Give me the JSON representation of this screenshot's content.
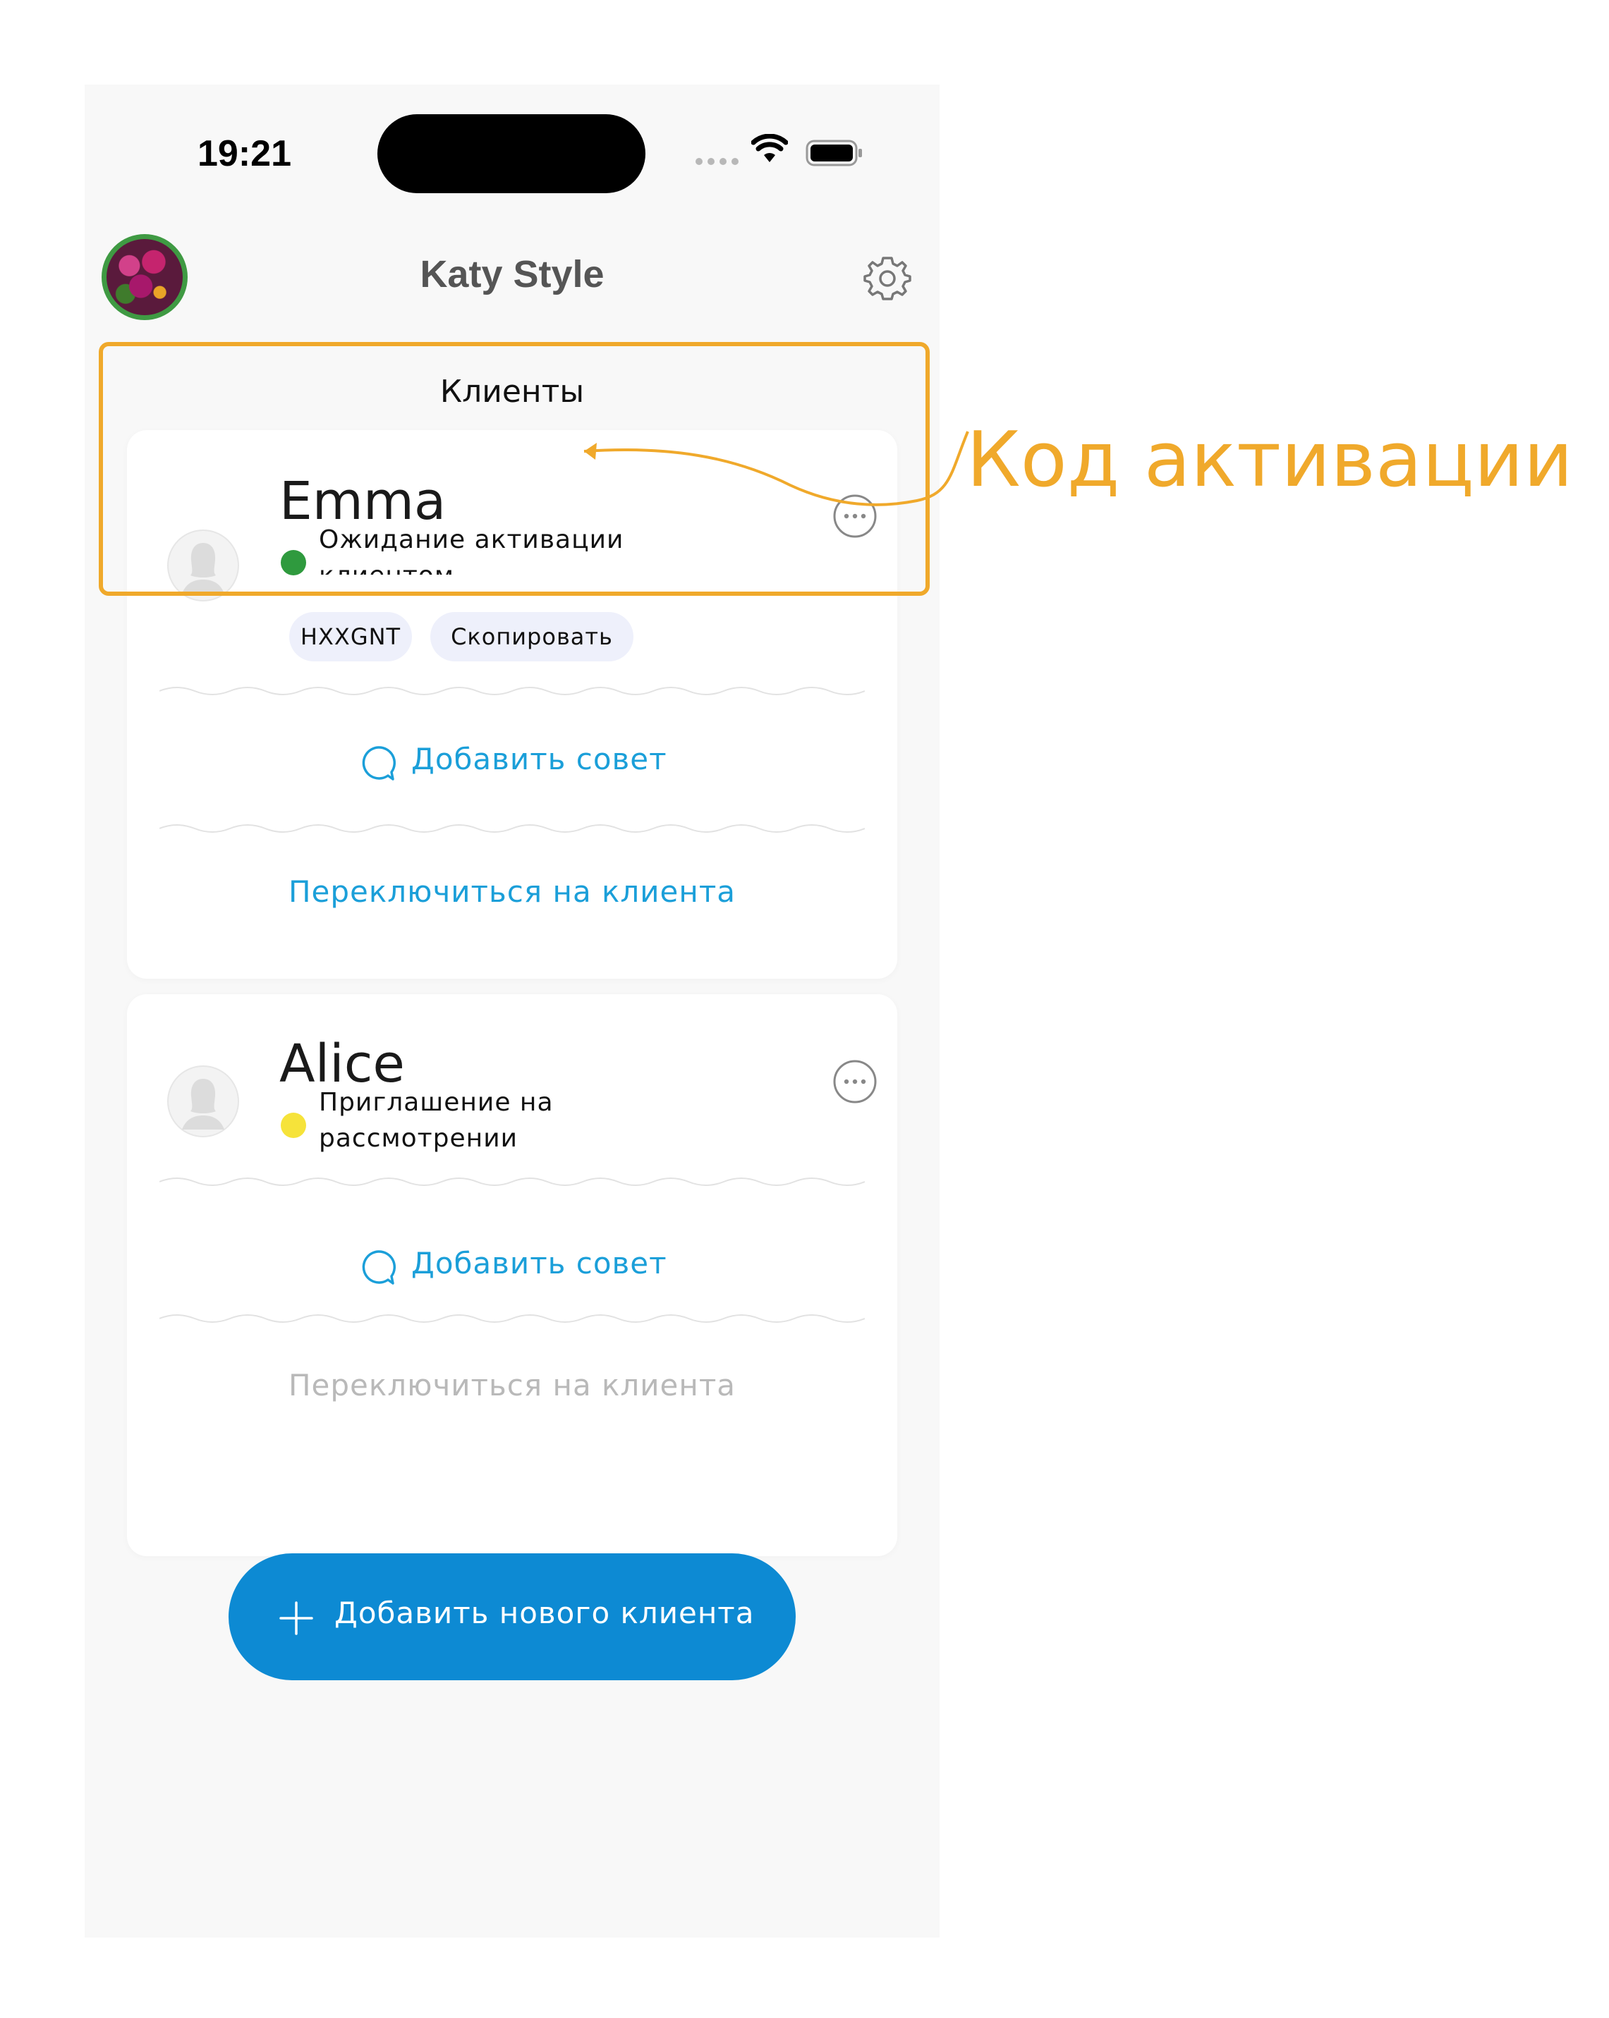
{
  "status_bar": {
    "time": "19:21"
  },
  "header": {
    "title": "Katy Style"
  },
  "section": {
    "title": "Клиенты"
  },
  "clients": [
    {
      "name": "Emma",
      "status": "Ожидание активации клиентом",
      "status_color": "#2f9a3e",
      "activation_code": "HXXGNT",
      "copy_label": "Скопировать",
      "advice_label": "Добавить совет",
      "switch_label": "Переключиться на клиента",
      "switch_enabled": true
    },
    {
      "name": "Alice",
      "status": "Приглашение на рассмотрении",
      "status_color": "#f6e33a",
      "advice_label": "Добавить совет",
      "switch_label": "Переключиться на клиента",
      "switch_enabled": false
    }
  ],
  "add_client_button": {
    "label": "Добавить нового клиента"
  },
  "annotation": {
    "label": "Код активации",
    "color": "#f0a92b"
  },
  "colors": {
    "accent": "#1b9fd9",
    "primary_button": "#0d8ad3",
    "background": "#f8f8f8"
  },
  "icons": [
    "person-icon",
    "more-icon",
    "chat-bubble-icon",
    "gear-icon",
    "plus-icon",
    "wifi-icon",
    "battery-icon"
  ]
}
